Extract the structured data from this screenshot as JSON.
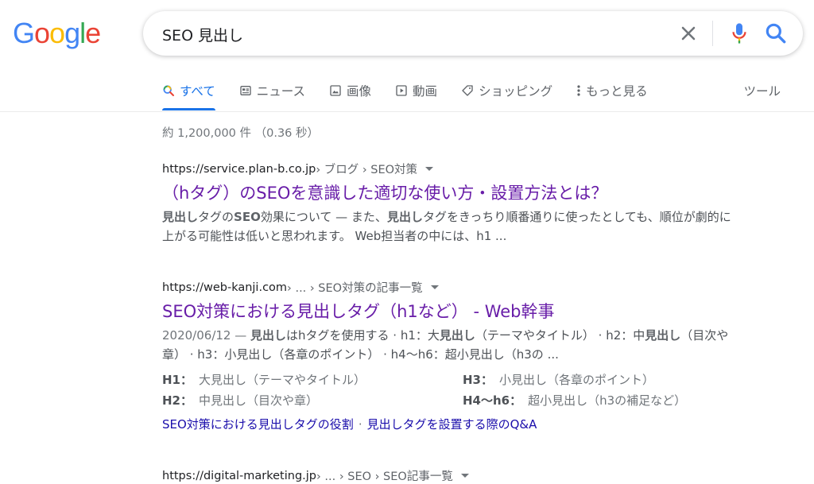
{
  "logo": {
    "letters": [
      "G",
      "o",
      "o",
      "g",
      "l",
      "e"
    ],
    "colors": [
      "#4285F4",
      "#EA4335",
      "#FBBC05",
      "#4285F4",
      "#34A853",
      "#EA4335"
    ]
  },
  "search": {
    "query": "SEO 見出し"
  },
  "tabs": [
    {
      "label": "すべて",
      "icon": "search-icon",
      "active": true
    },
    {
      "label": "ニュース",
      "icon": "news-icon",
      "active": false
    },
    {
      "label": "画像",
      "icon": "image-icon",
      "active": false
    },
    {
      "label": "動画",
      "icon": "video-icon",
      "active": false
    },
    {
      "label": "ショッピング",
      "icon": "tag-icon",
      "active": false
    },
    {
      "label": "もっと見る",
      "icon": "more-vert-icon",
      "active": false
    }
  ],
  "tools_label": "ツール",
  "stats": "約 1,200,000 件 （0.36 秒）",
  "results": [
    {
      "url_base": "https://service.plan-b.co.jp",
      "url_crumbs": " › ブログ › SEO対策",
      "title": "（hタグ）のSEOを意識した適切な使い方・設置方法とは？",
      "snippet_html": "<b>見出し</b>タグの<b>SEO</b>効果について — また、<b>見出し</b>タグをきっちり順番通りに使ったとしても、順位が劇的に上がる可能性は低いと思われます。 Web担当者の中には、h1 ..."
    },
    {
      "url_base": "https://web-kanji.com",
      "url_crumbs": " › ... › SEO対策の記事一覧",
      "title": "SEO対策における見出しタグ（h1など） - Web幹事",
      "snippet_html": "<span class=\"date\">2020/06/12 — </span><b>見出し</b>はhタグを使用する · h1：大<b>見出し</b>（テーマやタイトル） · h2：中<b>見出し</b>（目次や章） · h3：小見出し（各章のポイント） · h4〜h6：超小見出し（h3の ...",
      "kv": [
        {
          "k": "H1：",
          "v": "大見出し（テーマやタイトル）"
        },
        {
          "k": "H3：",
          "v": "小見出し（各章のポイント）"
        },
        {
          "k": "H2：",
          "v": "中見出し（目次や章）"
        },
        {
          "k": "H4〜h6：",
          "v": "超小見出し（h3の補足など）"
        }
      ],
      "sitelinks": [
        "SEO対策における見出しタグの役割",
        "見出しタグを設置する際のQ&A"
      ]
    },
    {
      "url_base": "https://digital-marketing.jp",
      "url_crumbs": " › ... › SEO › SEO記事一覧"
    }
  ]
}
